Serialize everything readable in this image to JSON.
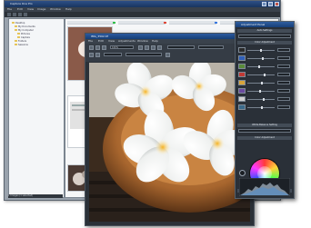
{
  "back_window": {
    "title": "Capture One Pro",
    "menu": [
      "File",
      "Edit",
      "View",
      "Image",
      "Window",
      "Help"
    ],
    "tree_items": [
      "Desktop",
      "My Documents",
      "My Computer",
      "Pictures",
      "Capture",
      "Folders",
      "Sessions"
    ],
    "status": "1 Images (1 selected)"
  },
  "viewer_window": {
    "title": "IMG_3502.tif",
    "menu": [
      "File",
      "Edit",
      "View",
      "Adjustments",
      "Window",
      "Help"
    ],
    "zoom": "100%"
  },
  "adjust_panel": {
    "title": "Adjustment Panel",
    "sections": [
      "Auto Settings",
      "Color Adjustment",
      "White Balance Setting",
      "Color Adjustment",
      "Histogram"
    ]
  },
  "colors": {
    "title_blue": "#1d4680",
    "panel_bg": "#2a3038",
    "accent_green": "#33c04b",
    "accent_red": "#e04a3a",
    "accent_blue": "#3a7ae0"
  }
}
